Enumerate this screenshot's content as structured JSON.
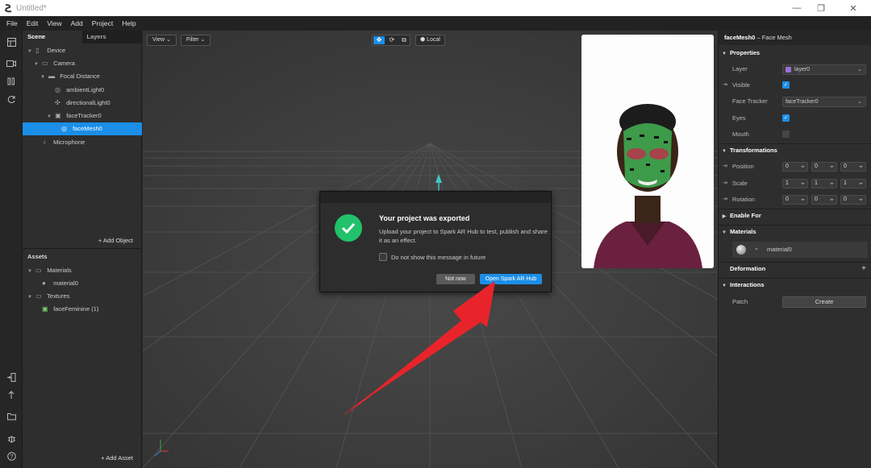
{
  "window": {
    "title": "Untitled*",
    "minimize": "—",
    "restore": "❐",
    "close": "✕"
  },
  "menu": [
    "File",
    "Edit",
    "View",
    "Add",
    "Project",
    "Help"
  ],
  "scene": {
    "tabs": [
      "Scene",
      "Layers"
    ],
    "tree": [
      {
        "label": "Device",
        "icon": "device-icon"
      },
      {
        "label": "Camera",
        "icon": "camera-icon"
      },
      {
        "label": "Focal Distance",
        "icon": "focal-distance-icon"
      },
      {
        "label": "ambientLight0",
        "icon": "light-icon"
      },
      {
        "label": "directionalLight0",
        "icon": "directional-light-icon"
      },
      {
        "label": "faceTracker0",
        "icon": "face-tracker-icon"
      },
      {
        "label": "faceMesh0",
        "icon": "face-mesh-icon"
      },
      {
        "label": "Microphone",
        "icon": "microphone-icon"
      }
    ],
    "add_object": "+  Add Object"
  },
  "assets": {
    "header": "Assets",
    "tree": [
      {
        "label": "Materials"
      },
      {
        "label": "material0"
      },
      {
        "label": "Textures"
      },
      {
        "label": "faceFeminine (1)"
      }
    ],
    "add_asset": "+  Add Asset"
  },
  "viewport": {
    "view_label": "View",
    "filter_label": "Filter",
    "local_label": "Local"
  },
  "dialog": {
    "title": "Your project was exported",
    "body": "Upload your project to Spark AR Hub to test, publish and share it as an effect.",
    "checkbox_label": "Do not show this message in future",
    "not_now": "Not now",
    "open_hub": "Open Spark AR Hub"
  },
  "inspector": {
    "object_name": "faceMesh0",
    "object_type": " – Face Mesh",
    "sections": {
      "properties": "Properties",
      "transformations": "Transformations",
      "enable_for": "Enable For",
      "materials": "Materials",
      "deformation": "Deformation",
      "interactions": "Interactions"
    },
    "layer": {
      "label": "Layer",
      "value": "layer0"
    },
    "visible": {
      "label": "Visible",
      "checked": true
    },
    "face_tracker": {
      "label": "Face Tracker",
      "value": "faceTracker0"
    },
    "eyes": {
      "label": "Eyes",
      "checked": true
    },
    "mouth": {
      "label": "Mouth",
      "checked": false
    },
    "position": {
      "label": "Position",
      "values": [
        "0",
        "0",
        "0"
      ]
    },
    "scale": {
      "label": "Scale",
      "values": [
        "1",
        "1",
        "1"
      ]
    },
    "rotation": {
      "label": "Rotation",
      "values": [
        "0",
        "0",
        "0"
      ]
    },
    "material_value": "material0",
    "deformation_plus": "+",
    "patch": {
      "label": "Patch",
      "button": "Create"
    }
  },
  "colors": {
    "accent": "#1b8ee8",
    "success": "#22c16b",
    "layer_swatch": "#9b6fd6",
    "arrow": "#e8242a"
  }
}
